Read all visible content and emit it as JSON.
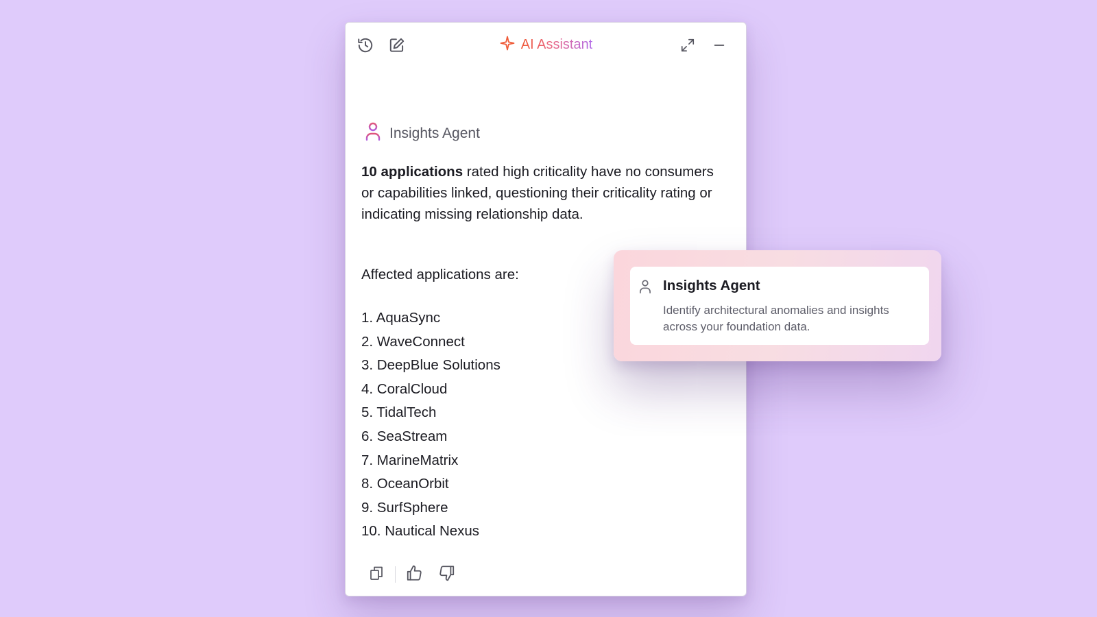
{
  "header": {
    "title": "AI Assistant",
    "icons": {
      "history": "history-icon",
      "new_chat": "edit-icon",
      "expand": "expand-icon",
      "minimize": "minimize-icon",
      "title": "sparkle-icon"
    }
  },
  "agent": {
    "name": "Insights Agent",
    "icon": "user-icon"
  },
  "message": {
    "bold_lead": "10 applications",
    "body": " rated high criticality have no consumers or capabilities linked, questioning their criticality rating or indicating missing relationship data.",
    "list_intro": "Affected applications are:",
    "applications": [
      "1. AquaSync",
      "2. WaveConnect",
      "3. DeepBlue Solutions",
      "4. CoralCloud",
      "5. TidalTech",
      "6. SeaStream",
      "7. MarineMatrix",
      "8. OceanOrbit",
      "9. SurfSphere",
      "10. Nautical Nexus"
    ]
  },
  "feedback": {
    "icons": [
      "copy-icon",
      "thumbs-up-icon",
      "thumbs-down-icon"
    ]
  },
  "popover": {
    "title": "Insights Agent",
    "description": "Identify architectural anomalies and insights across your foundation data."
  },
  "colors": {
    "background": "#dfcbfb",
    "title_gradient_start": "#ef5a37",
    "title_gradient_end": "#b16ae8",
    "agent_icon_top": "#e0557a",
    "agent_icon_bottom": "#b15ee0"
  }
}
